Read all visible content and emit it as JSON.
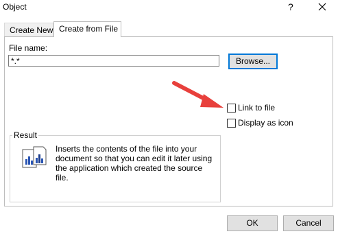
{
  "window": {
    "title": "Object",
    "help_glyph": "?"
  },
  "tabs": [
    {
      "label": "Create New",
      "active": false
    },
    {
      "label": "Create from File",
      "active": true
    }
  ],
  "file": {
    "label": "File name:",
    "value": "*.*",
    "browse_label": "Browse..."
  },
  "options": {
    "link_label": "Link to file",
    "link_checked": false,
    "display_icon_label": "Display as icon",
    "display_icon_checked": false
  },
  "result": {
    "legend": "Result",
    "text": "Inserts the contents of the file into your document so that you can edit it later using the application which created the source file."
  },
  "footer": {
    "ok_label": "OK",
    "cancel_label": "Cancel"
  },
  "colors": {
    "focus_border": "#0078d7",
    "arrow": "#e8403c"
  },
  "icons": [
    "close-icon",
    "file-chart-icon",
    "annotation-arrow"
  ]
}
